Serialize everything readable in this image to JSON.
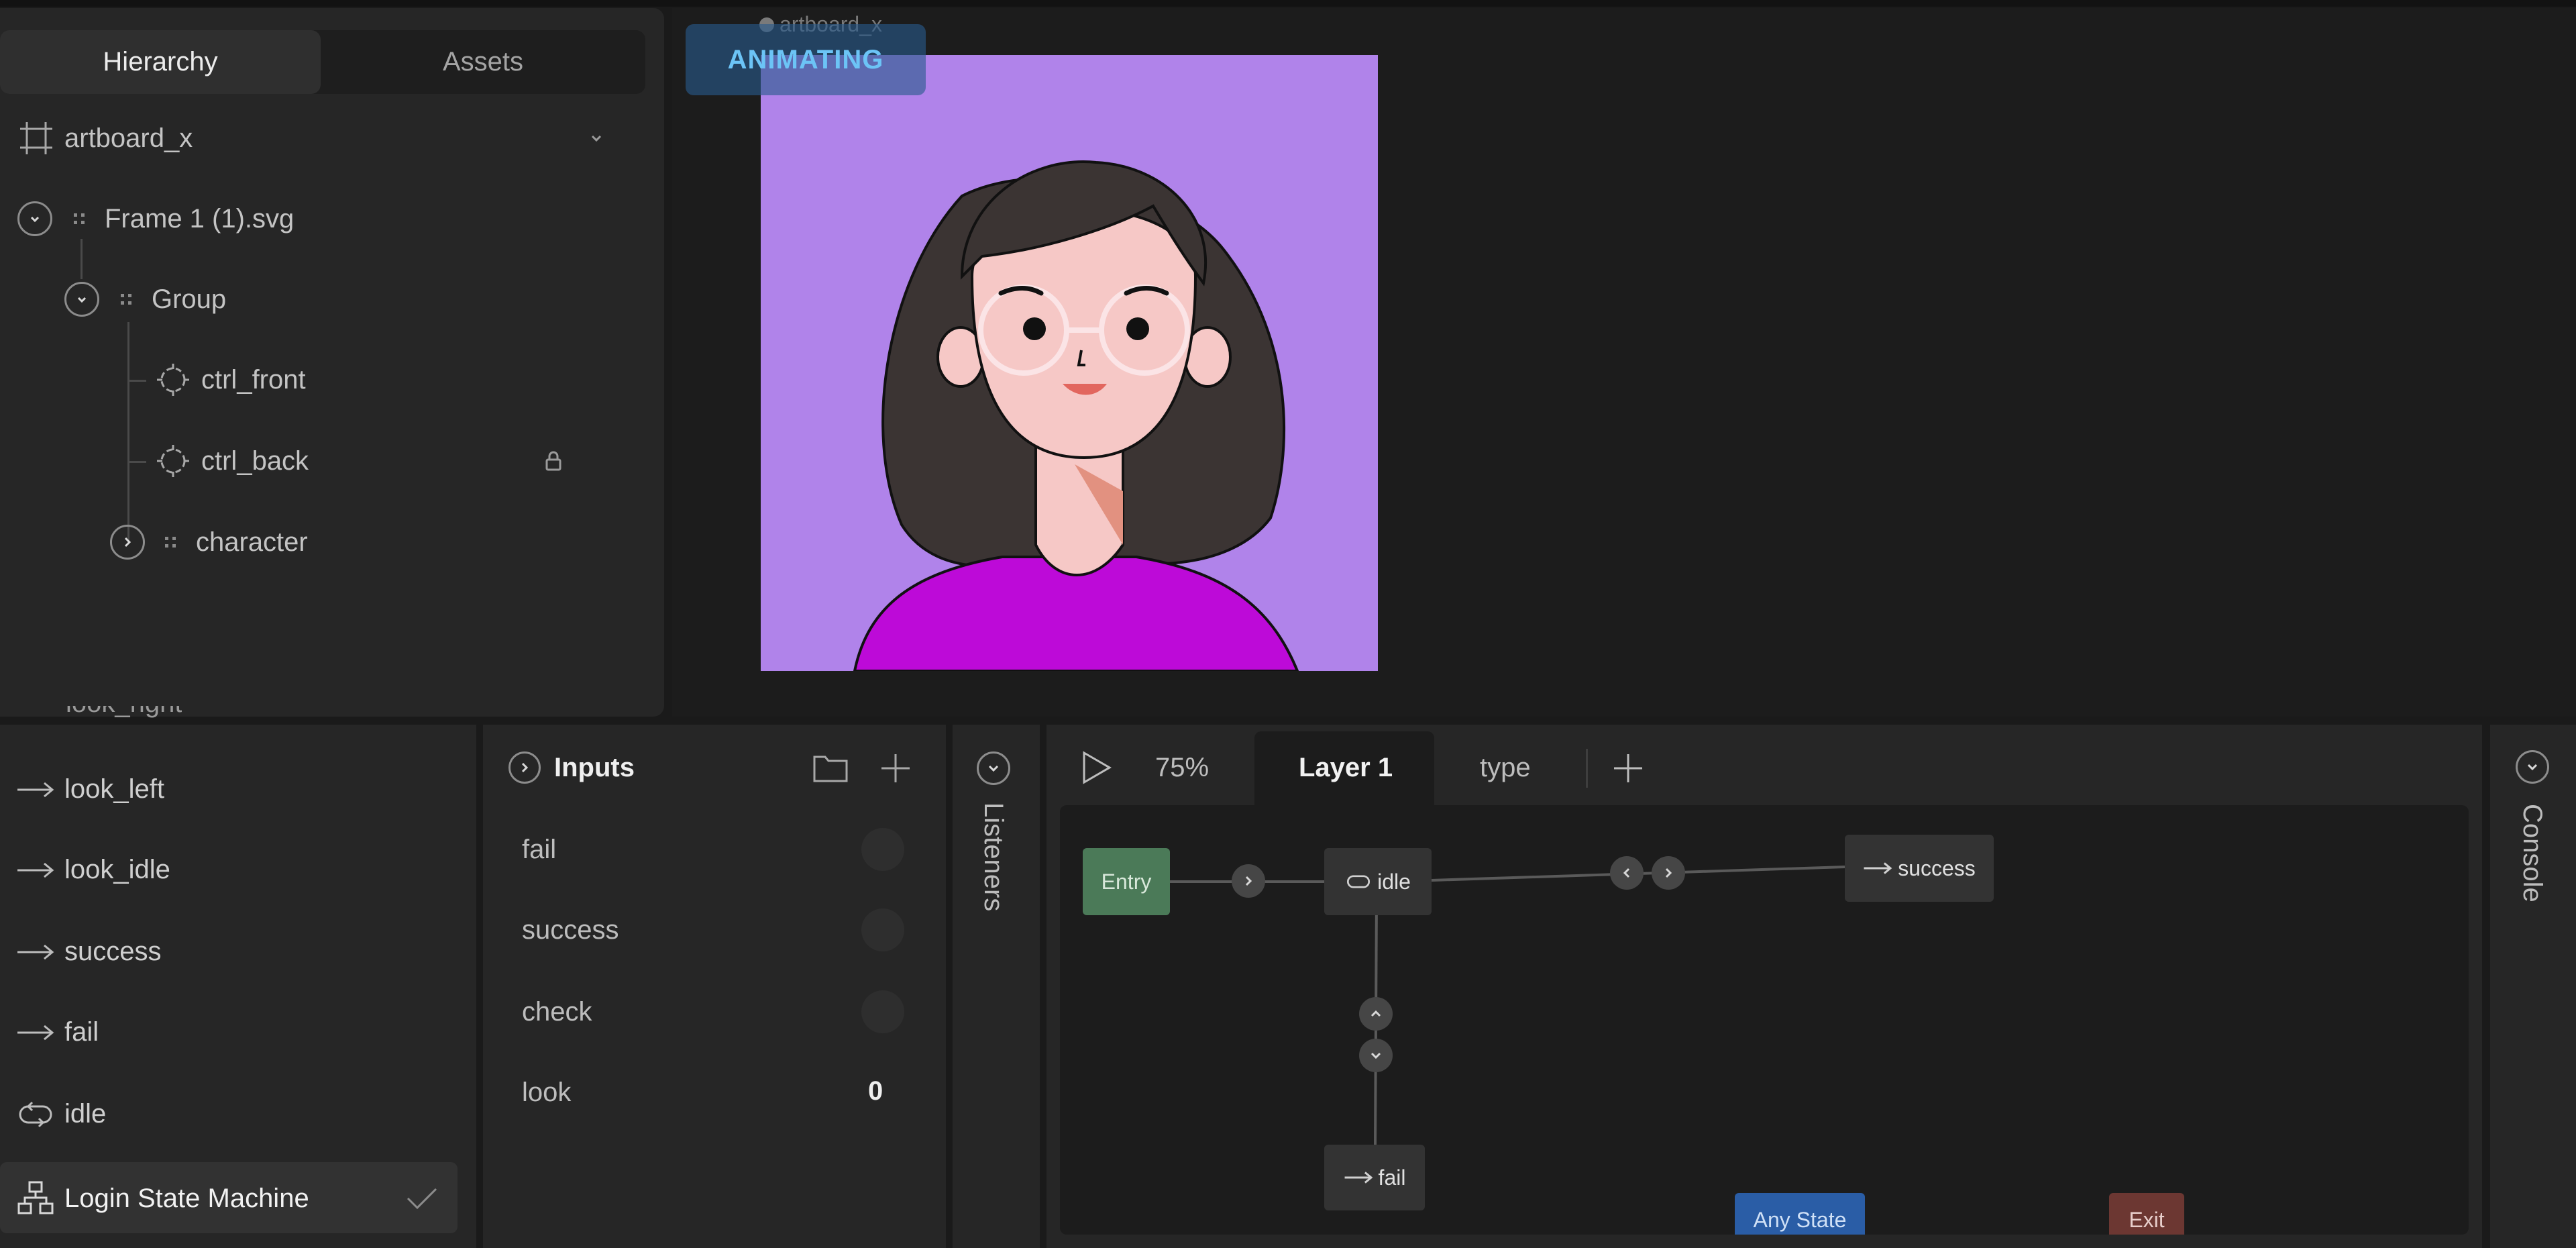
{
  "hierarchy": {
    "tabs": [
      "Hierarchy",
      "Assets"
    ],
    "active_tab": "Hierarchy",
    "artboard": "artboard_x",
    "nodes": {
      "frame": "Frame 1 (1).svg",
      "group": "Group",
      "ctrl_front": "ctrl_front",
      "ctrl_back": "ctrl_back",
      "character": "character"
    }
  },
  "stage": {
    "artboard_label": "artboard_x",
    "badge": "ANIMATING",
    "colors": {
      "background": "#b083ea",
      "hair": "#3b3433",
      "skin": "#f6c8c6",
      "shirt": "#bd0ad8"
    }
  },
  "state_machine": {
    "partial_item": "look_right",
    "items": [
      {
        "label": "look_left",
        "icon": "arrow-right-icon"
      },
      {
        "label": "look_idle",
        "icon": "arrow-right-icon"
      },
      {
        "label": "success",
        "icon": "arrow-right-icon"
      },
      {
        "label": "fail",
        "icon": "arrow-right-icon"
      },
      {
        "label": "idle",
        "icon": "loop-icon"
      }
    ],
    "selected": "Login State Machine"
  },
  "inputs": {
    "title": "Inputs",
    "rows": [
      {
        "name": "fail",
        "type": "trigger"
      },
      {
        "name": "success",
        "type": "trigger"
      },
      {
        "name": "check",
        "type": "trigger"
      }
    ],
    "number_input": {
      "name": "look",
      "value": "0"
    }
  },
  "listeners": {
    "label": "Listeners"
  },
  "graph": {
    "zoom": "75%",
    "layer_tabs": [
      "Layer 1",
      "type"
    ],
    "active_layer": "Layer 1",
    "nodes": {
      "entry": "Entry",
      "idle": "idle",
      "success": "success",
      "fail": "fail",
      "any_state": "Any State",
      "exit": "Exit"
    },
    "colors": {
      "entry": "#4b7a58",
      "any_state": "#2a5da6",
      "exit": "#6c3732",
      "state": "#333333"
    }
  },
  "console": {
    "label": "Console"
  }
}
